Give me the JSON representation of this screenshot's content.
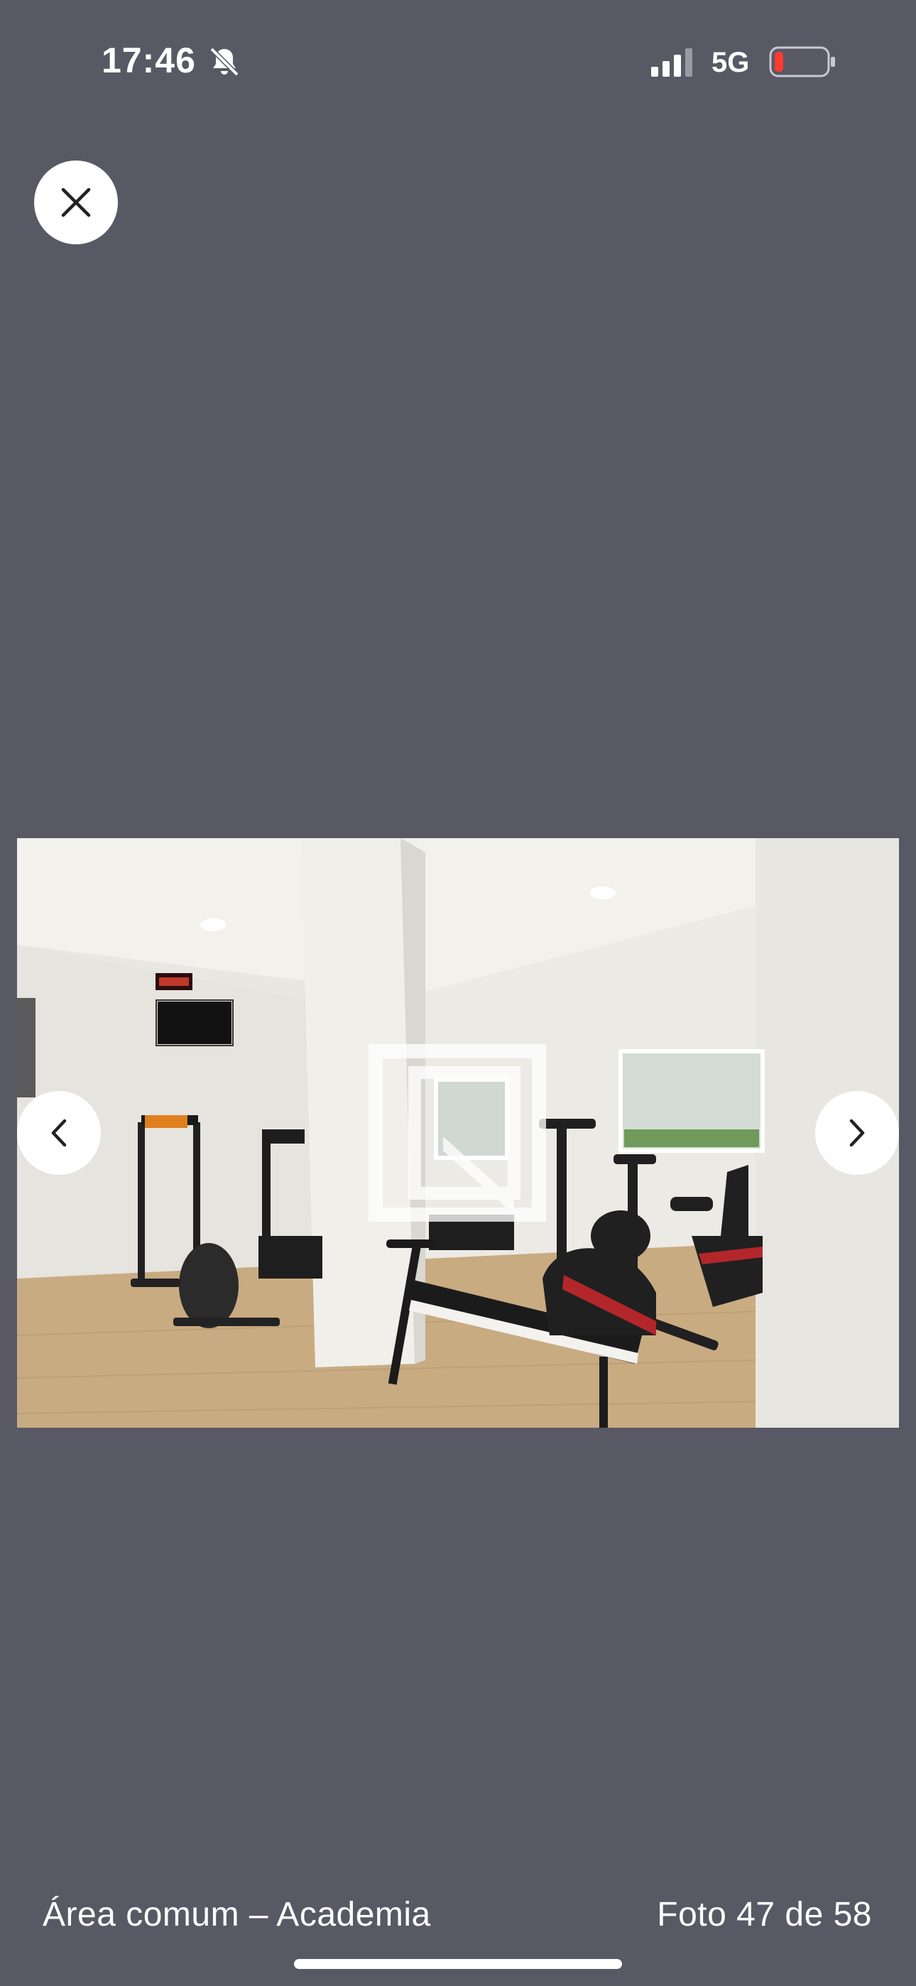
{
  "status_bar": {
    "time": "17:46",
    "silent_icon": "bell-slash-icon",
    "signal_icon": "cellular-signal-icon",
    "network": "5G",
    "battery_icon": "battery-low-icon",
    "battery_color": "#ff3b30"
  },
  "viewer": {
    "close_icon": "close-icon",
    "prev_icon": "chevron-left-icon",
    "next_icon": "chevron-right-icon",
    "photo_subject": "gym-photo",
    "watermark_icon": "brand-watermark-icon"
  },
  "footer": {
    "caption": "Área comum – Academia",
    "counter": "Foto 47 de 58"
  },
  "colors": {
    "background": "#595965",
    "button": "#ffffff",
    "text": "#ffffff"
  }
}
